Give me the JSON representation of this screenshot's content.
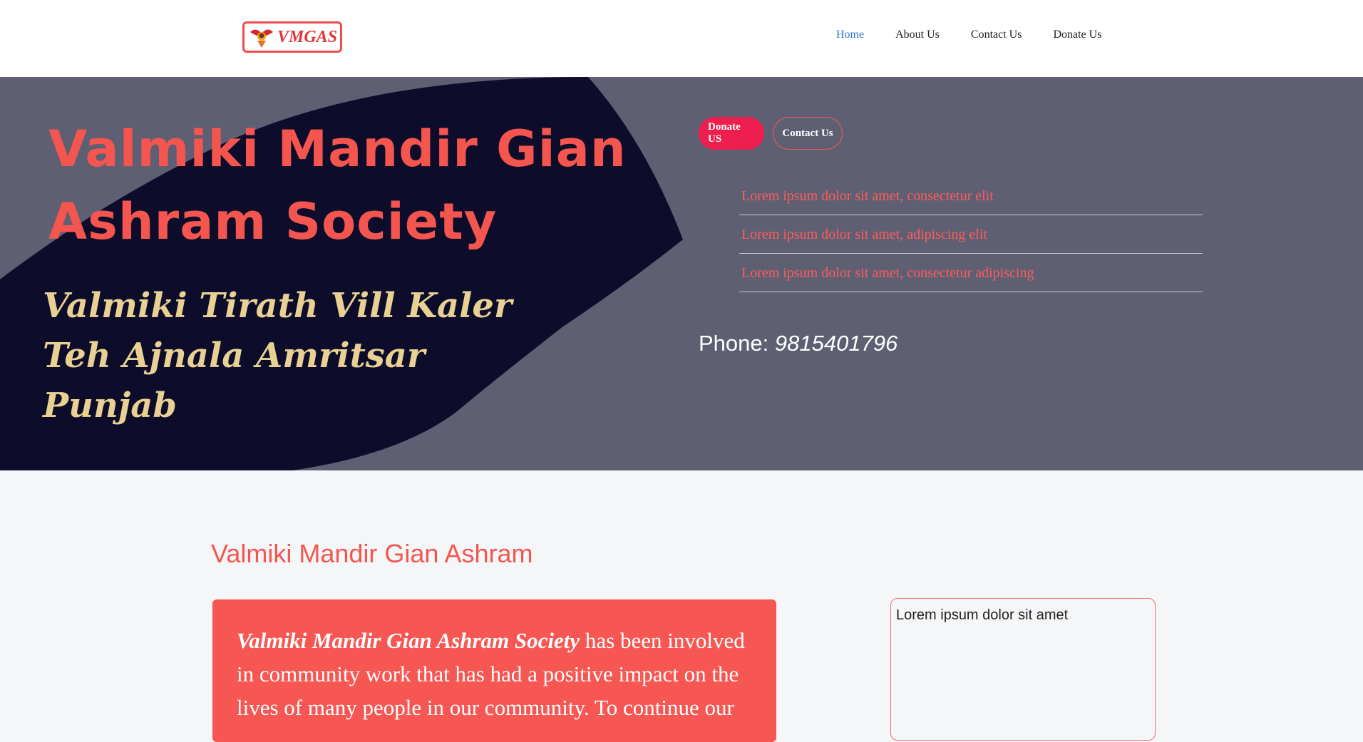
{
  "header": {
    "logo_text": "VMGAS",
    "nav": [
      {
        "label": "Home",
        "active": true
      },
      {
        "label": "About Us",
        "active": false
      },
      {
        "label": "Contact Us",
        "active": false
      },
      {
        "label": "Donate Us",
        "active": false
      }
    ]
  },
  "hero": {
    "title": "Valmiki Mandir Gian Ashram Society",
    "address_lines": [
      "Valmiki Tirath Vill Kaler",
      "Teh Ajnala Amritsar",
      "Punjab"
    ],
    "donate_button": "Donate US",
    "contact_button": "Contact Us",
    "features": [
      "Lorem ipsum dolor sit amet, consectetur elit",
      "Lorem ipsum dolor sit amet, adipiscing elit",
      "Lorem ipsum dolor sit amet, consectetur adipiscing"
    ],
    "phone_label": "Phone:",
    "phone_number": "9815401796"
  },
  "content": {
    "section_title": "Valmiki Mandir Gian Ashram",
    "card_bold": "Valmiki Mandir Gian Ashram Society",
    "card_text": " has been involved in community work that has had a positive impact on the lives of many people in our community. To continue our",
    "side_text": "Lorem ipsum dolor sit amet"
  },
  "colors": {
    "accent": "#f4564f",
    "hero_bg": "#5e5f72",
    "hero_shape": "#0d0d2b",
    "address": "#e8d192",
    "donate": "#ee1f4f",
    "nav_active": "#2f74c6"
  }
}
